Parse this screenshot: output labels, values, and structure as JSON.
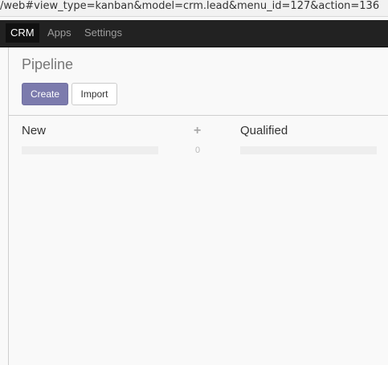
{
  "browser": {
    "url": "/web#view_type=kanban&model=crm.lead&menu_id=127&action=136"
  },
  "topnav": {
    "items": [
      {
        "label": "CRM",
        "active": true
      },
      {
        "label": "Apps",
        "active": false
      },
      {
        "label": "Settings",
        "active": false
      }
    ]
  },
  "page": {
    "title": "Pipeline"
  },
  "buttons": {
    "create_label": "Create",
    "import_label": "Import"
  },
  "kanban": {
    "columns": [
      {
        "title": "New",
        "add_icon": "plus-icon",
        "add_glyph": "+",
        "count": "0"
      },
      {
        "title": "Qualified"
      }
    ]
  },
  "colors": {
    "primary": "#7c7bad",
    "navbar": "#222222",
    "navbar_active": "#111111",
    "background": "#f9f9f9"
  }
}
